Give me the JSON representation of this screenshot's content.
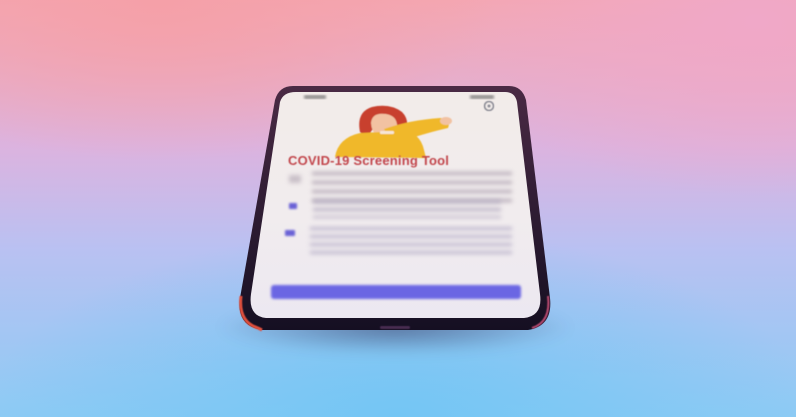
{
  "screen": {
    "title": "COVID-19 Screening Tool"
  },
  "colors": {
    "title": "#c2464c",
    "accent": "#6b66e3",
    "illustration_yellow": "#f0b82a",
    "hair": "#c8402e"
  },
  "icons": {
    "illustration": "person-coughing-illustration",
    "settings": "gear-icon",
    "list_bullets": "checkbox-icon"
  }
}
